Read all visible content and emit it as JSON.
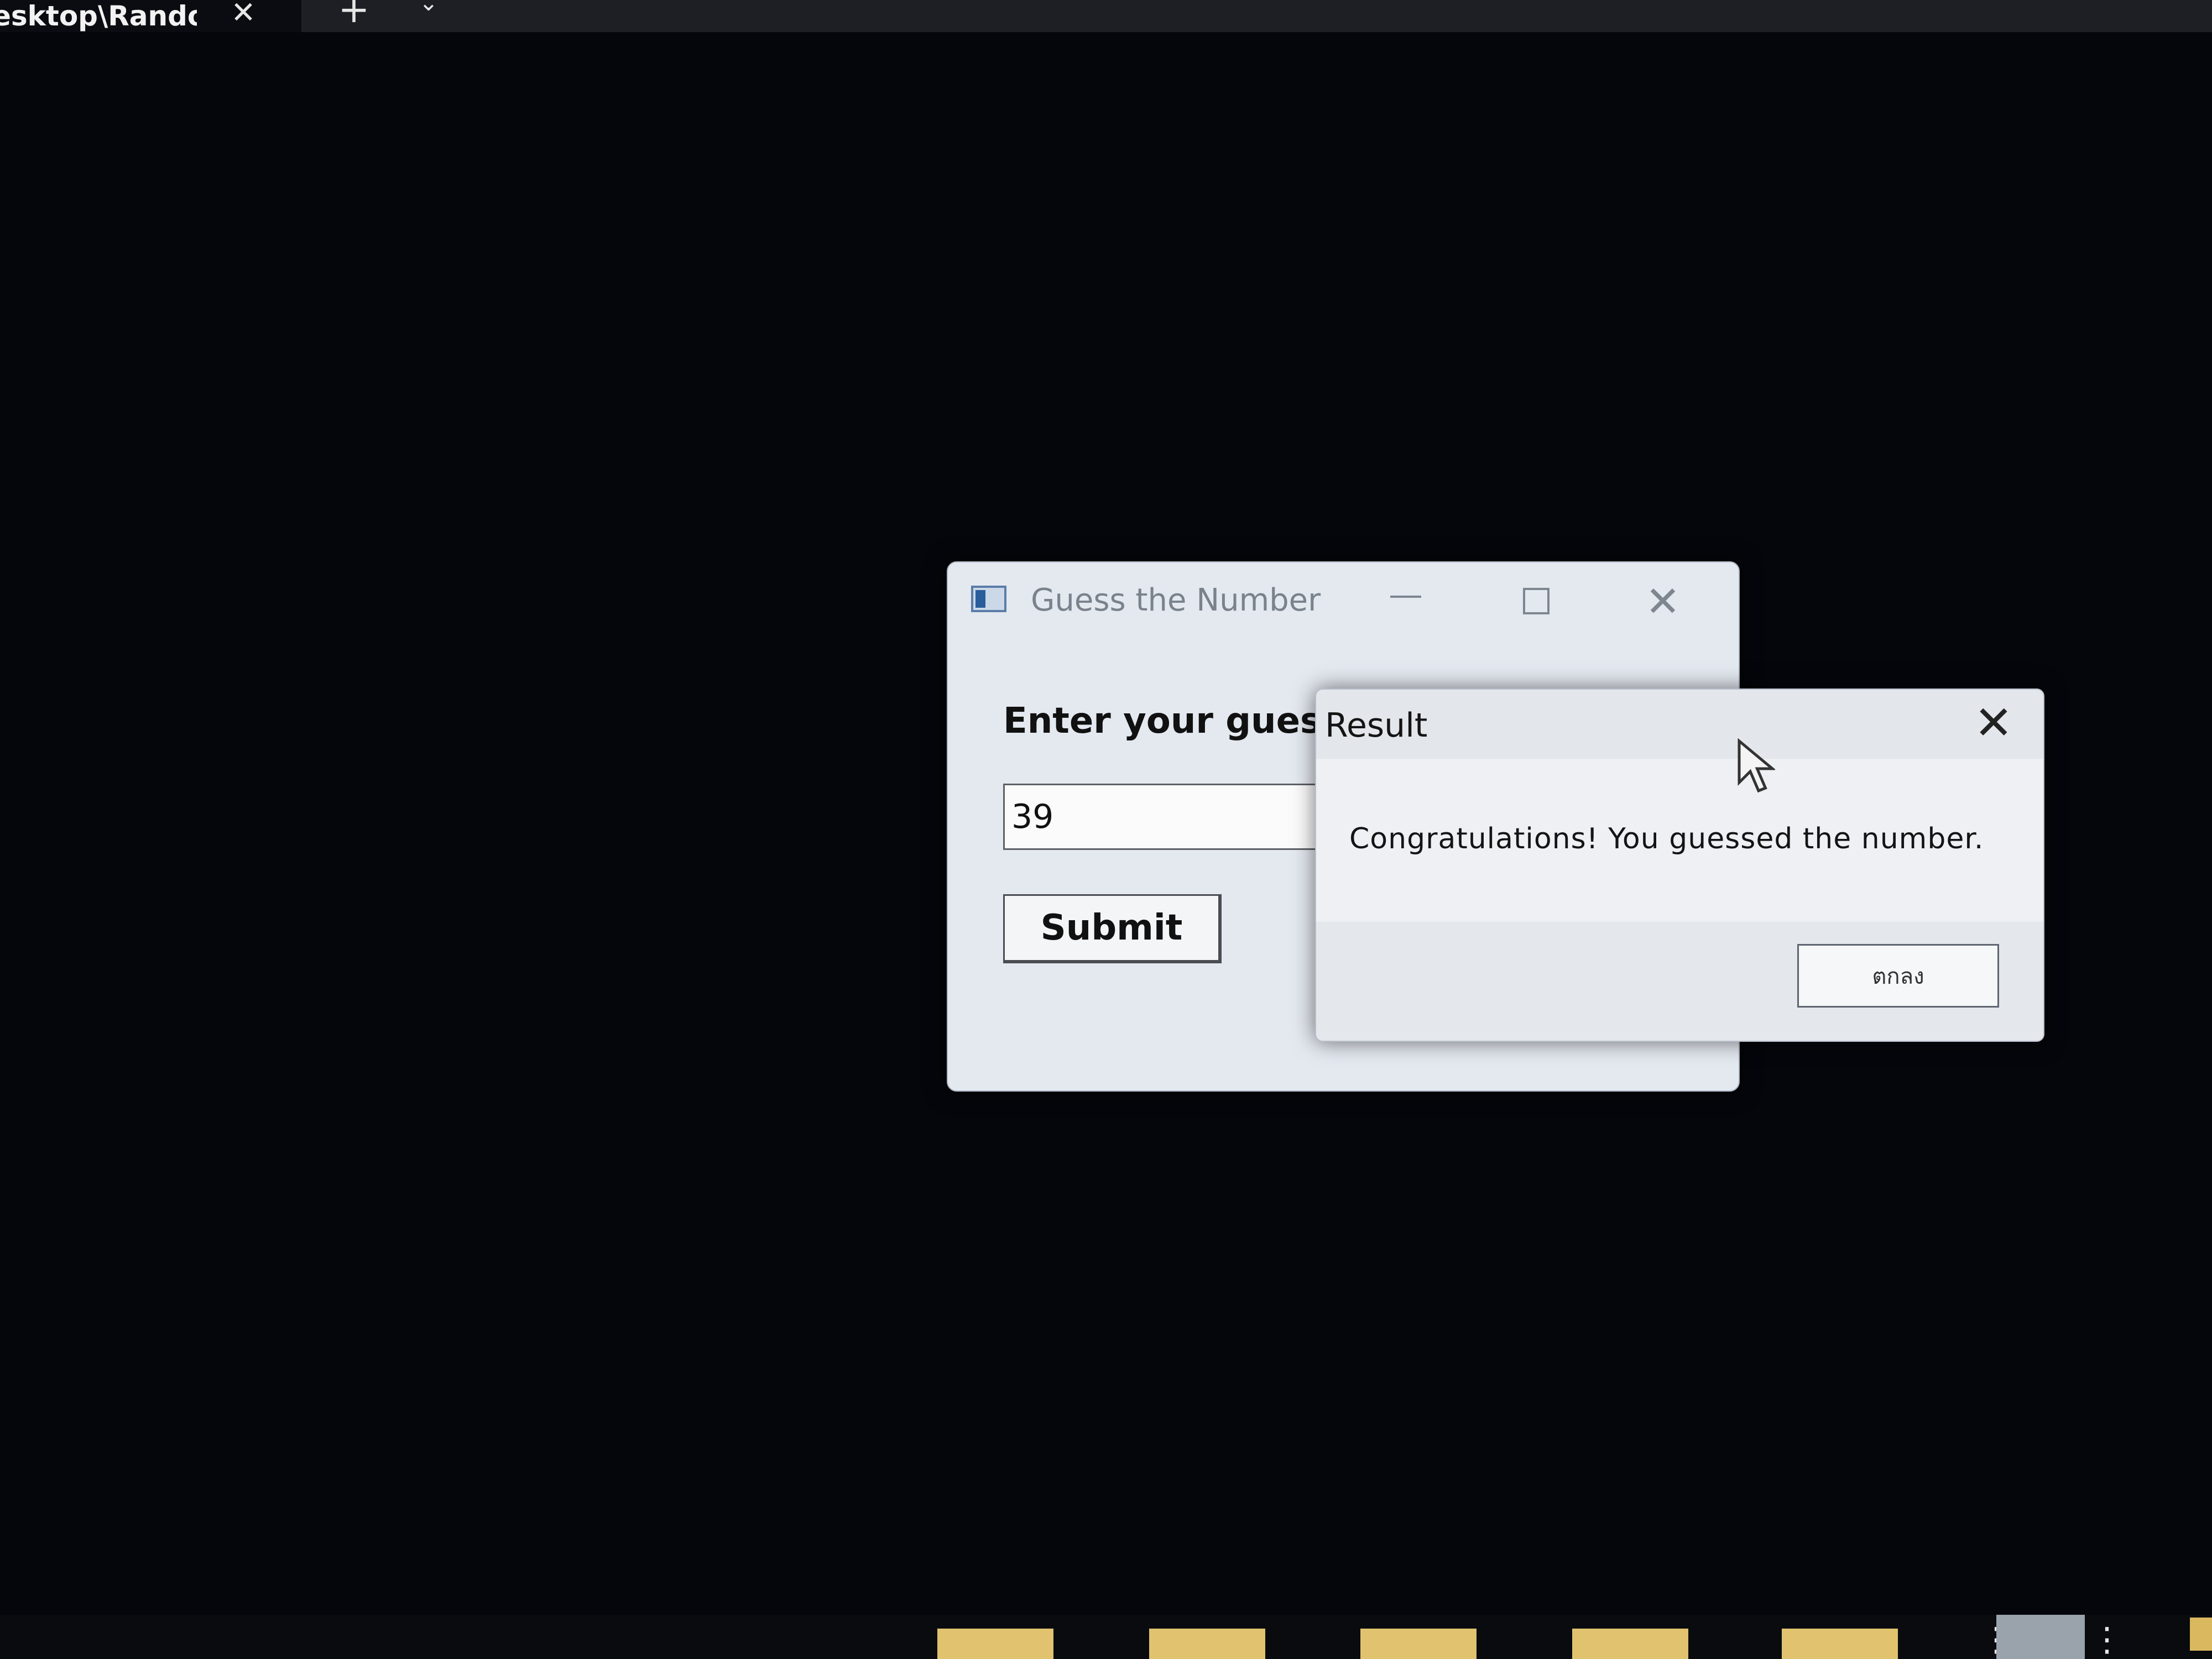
{
  "terminal": {
    "tab_title": "esktop\\Randoı",
    "tab_close_glyph": "✕",
    "new_tab_glyph": "+",
    "dropdown_glyph": "⌄"
  },
  "main_window": {
    "title": "Guess the Number",
    "prompt_label": "Enter your guess:",
    "guess_value": "39",
    "submit_label": "Submit"
  },
  "dialog": {
    "title": "Result",
    "message": "Congratulations! You guessed the number.",
    "ok_label": "ตกลง",
    "close_glyph": "✕"
  },
  "icons": {
    "app": "app-window-icon",
    "minimize": "minimize-icon",
    "maximize": "maximize-icon",
    "close": "close-icon",
    "cursor": "mouse-pointer-icon"
  },
  "colors": {
    "desktop_background": "#05060b",
    "window_background": "#e4e9f0",
    "dialog_background": "#eef0f3",
    "taskbar_tile": "#e0c26f"
  }
}
